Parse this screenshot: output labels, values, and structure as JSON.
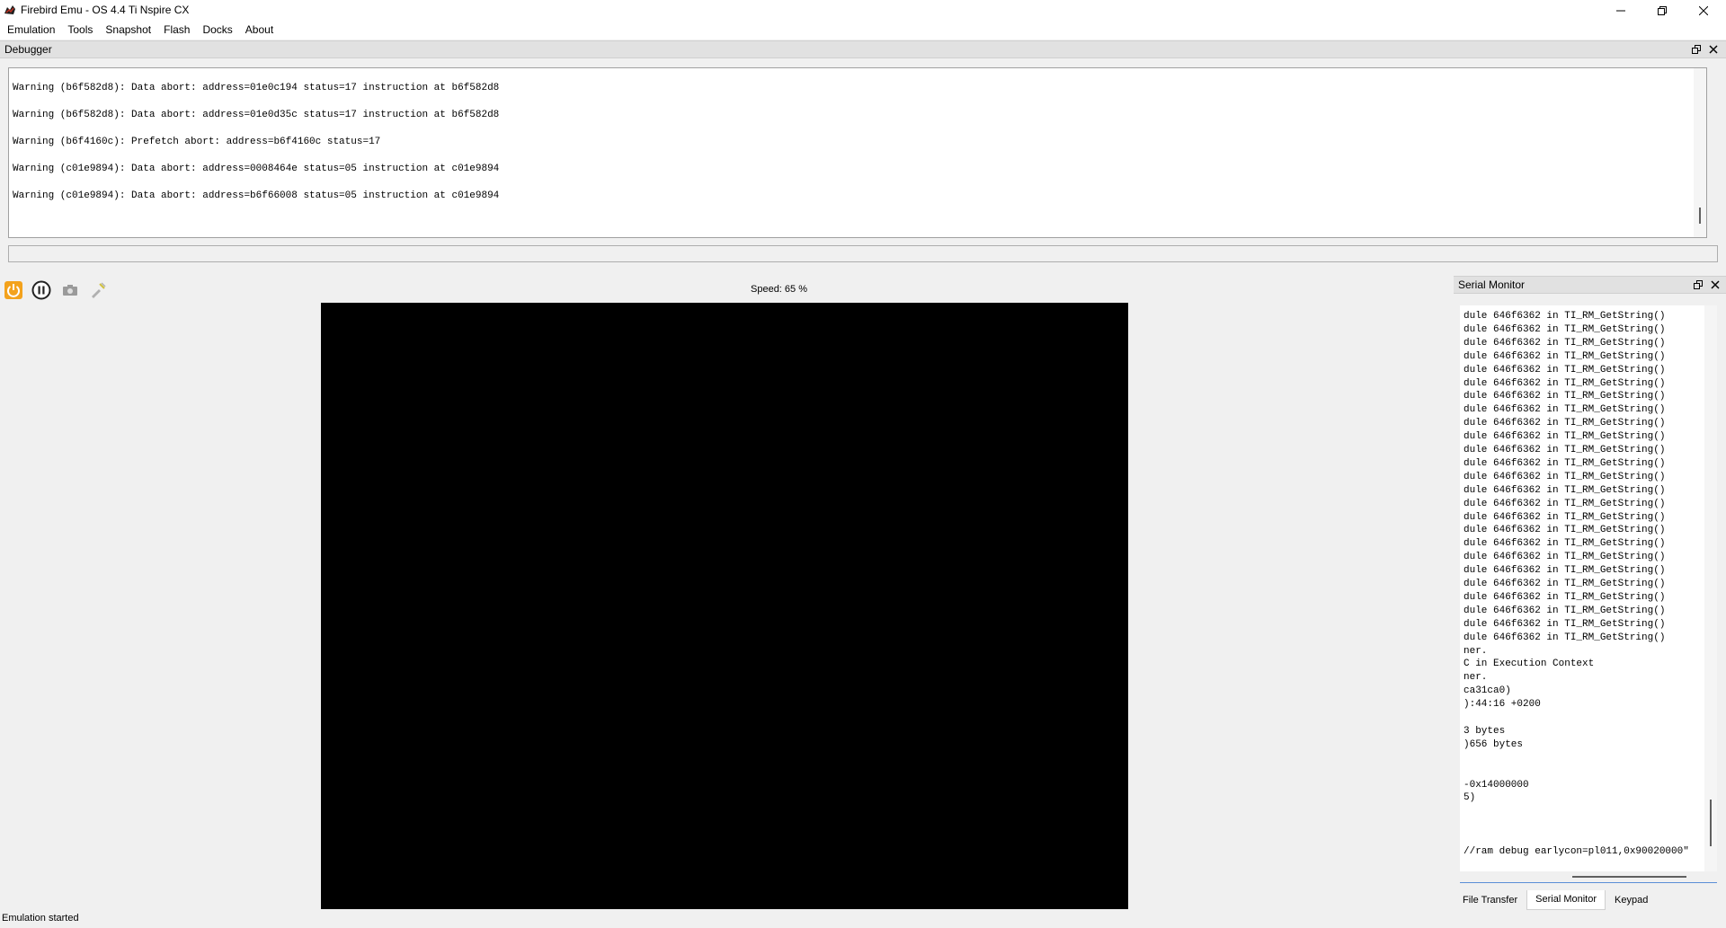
{
  "window": {
    "title": "Firebird Emu - OS 4.4 Ti Nspire CX"
  },
  "menu": [
    "Emulation",
    "Tools",
    "Snapshot",
    "Flash",
    "Docks",
    "About"
  ],
  "debugger": {
    "title": "Debugger",
    "log": [
      "Warning (b6f582d8): Data abort: address=01e0c194 status=17 instruction at b6f582d8",
      "Warning (b6f582d8): Data abort: address=01e0d35c status=17 instruction at b6f582d8",
      "Warning (b6f4160c): Prefetch abort: address=b6f4160c status=17",
      "Warning (c01e9894): Data abort: address=0008464e status=05 instruction at c01e9894",
      "Warning (c01e9894): Data abort: address=b6f66008 status=05 instruction at c01e9894"
    ]
  },
  "toolbar": {
    "speed": "Speed: 65 %",
    "icons": [
      "power-icon",
      "pause-icon",
      "screenshot-icon",
      "record-icon"
    ]
  },
  "serial_monitor": {
    "title": "Serial Monitor",
    "lines": [
      "dule 646f6362 in TI_RM_GetString()",
      "dule 646f6362 in TI_RM_GetString()",
      "dule 646f6362 in TI_RM_GetString()",
      "dule 646f6362 in TI_RM_GetString()",
      "dule 646f6362 in TI_RM_GetString()",
      "dule 646f6362 in TI_RM_GetString()",
      "dule 646f6362 in TI_RM_GetString()",
      "dule 646f6362 in TI_RM_GetString()",
      "dule 646f6362 in TI_RM_GetString()",
      "dule 646f6362 in TI_RM_GetString()",
      "dule 646f6362 in TI_RM_GetString()",
      "dule 646f6362 in TI_RM_GetString()",
      "dule 646f6362 in TI_RM_GetString()",
      "dule 646f6362 in TI_RM_GetString()",
      "dule 646f6362 in TI_RM_GetString()",
      "dule 646f6362 in TI_RM_GetString()",
      "dule 646f6362 in TI_RM_GetString()",
      "dule 646f6362 in TI_RM_GetString()",
      "dule 646f6362 in TI_RM_GetString()",
      "dule 646f6362 in TI_RM_GetString()",
      "dule 646f6362 in TI_RM_GetString()",
      "dule 646f6362 in TI_RM_GetString()",
      "dule 646f6362 in TI_RM_GetString()",
      "dule 646f6362 in TI_RM_GetString()",
      "dule 646f6362 in TI_RM_GetString()",
      "ner.",
      "C in Execution Context",
      "ner.",
      "ca31ca0)",
      "):44:16 +0200",
      "",
      "3 bytes",
      ")656 bytes",
      "",
      "",
      "-0x14000000",
      "5)",
      "",
      "",
      "",
      "//ram debug earlycon=pl011,0x90020000\""
    ]
  },
  "dock_tabs": [
    "File Transfer",
    "Serial Monitor",
    "Keypad"
  ],
  "status": "Emulation started"
}
